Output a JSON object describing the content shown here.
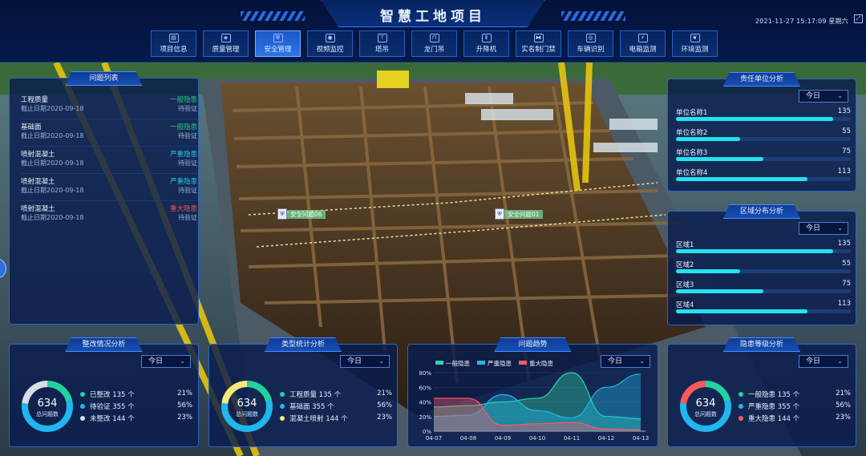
{
  "header": {
    "title": "智慧工地项目",
    "datetime": "2021-11-27 15:17:09 星期六",
    "fullscreen_icon": "fullscreen-icon"
  },
  "nav": [
    {
      "label": "项目信息",
      "icon": "document-icon",
      "active": false
    },
    {
      "label": "质量管理",
      "icon": "quality-badge-icon",
      "active": false
    },
    {
      "label": "安全管理",
      "icon": "shield-icon",
      "active": true
    },
    {
      "label": "视频监控",
      "icon": "camera-icon",
      "active": false
    },
    {
      "label": "塔吊",
      "icon": "tower-crane-icon",
      "active": false
    },
    {
      "label": "龙门吊",
      "icon": "gantry-crane-icon",
      "active": false
    },
    {
      "label": "升降机",
      "icon": "elevator-icon",
      "active": false
    },
    {
      "label": "实名制门禁",
      "icon": "gate-icon",
      "active": false
    },
    {
      "label": "车辆识别",
      "icon": "car-icon",
      "active": false
    },
    {
      "label": "电箱监测",
      "icon": "electric-box-icon",
      "active": false
    },
    {
      "label": "环境监测",
      "icon": "leaf-icon",
      "active": false
    }
  ],
  "issue_list": {
    "title": "问题列表",
    "items": [
      {
        "name": "工程质量",
        "date": "截止日期2020-09-18",
        "level": "一般隐患",
        "level_color": "#22c97a",
        "status": "待验证"
      },
      {
        "name": "基础面",
        "date": "截止日期2020-09-18",
        "level": "一般隐患",
        "level_color": "#22c97a",
        "status": "待验证"
      },
      {
        "name": "喷射混凝土",
        "date": "截止日期2020-09-18",
        "level": "严重隐患",
        "level_color": "#22c8e8",
        "status": "待验证"
      },
      {
        "name": "喷射混凝土",
        "date": "截止日期2020-09-18",
        "level": "严重隐患",
        "level_color": "#22c8e8",
        "status": "待验证"
      },
      {
        "name": "喷射混凝土",
        "date": "截止日期2020-09-18",
        "level": "重大隐患",
        "level_color": "#ff4d4d",
        "status": "待验证"
      }
    ]
  },
  "responsible_units": {
    "title": "责任单位分析",
    "select": "今日",
    "max": 150,
    "items": [
      {
        "label": "单位名称1",
        "value": 135
      },
      {
        "label": "单位名称2",
        "value": 55
      },
      {
        "label": "单位名称3",
        "value": 75
      },
      {
        "label": "单位名称4",
        "value": 113
      }
    ]
  },
  "area_distribution": {
    "title": "区域分布分析",
    "select": "今日",
    "max": 150,
    "items": [
      {
        "label": "区域1",
        "value": 135
      },
      {
        "label": "区域2",
        "value": 55
      },
      {
        "label": "区域3",
        "value": 75
      },
      {
        "label": "区域4",
        "value": 113
      }
    ]
  },
  "rectification": {
    "title": "整改情况分析",
    "select": "今日",
    "total": "634",
    "total_label": "总问题数",
    "items": [
      {
        "label": "已整改 135 个",
        "pct": "21%",
        "value": 21,
        "color": "#22d3a0"
      },
      {
        "label": "待验证 355 个",
        "pct": "56%",
        "value": 56,
        "color": "#1fb7ee"
      },
      {
        "label": "未整改 144 个",
        "pct": "23%",
        "value": 23,
        "color": "#d8dde6"
      }
    ]
  },
  "type_stats": {
    "title": "类型统计分析",
    "select": "今日",
    "total": "634",
    "total_label": "总问题数",
    "items": [
      {
        "label": "工程质量 135 个",
        "pct": "21%",
        "value": 21,
        "color": "#22d3a0"
      },
      {
        "label": "基础面 355 个",
        "pct": "56%",
        "value": 56,
        "color": "#1fb7ee"
      },
      {
        "label": "混凝土喷射 144 个",
        "pct": "23%",
        "value": 23,
        "color": "#f5e97a"
      }
    ]
  },
  "hazard_levels": {
    "title": "隐患等级分析",
    "select": "今日",
    "total": "634",
    "total_label": "总问题数",
    "items": [
      {
        "label": "一般隐患 135 个",
        "pct": "21%",
        "value": 21,
        "color": "#22d3a0"
      },
      {
        "label": "严重隐患 355 个",
        "pct": "56%",
        "value": 56,
        "color": "#1fb7ee"
      },
      {
        "label": "重大隐患 144 个",
        "pct": "23%",
        "value": 23,
        "color": "#ff5a5a"
      }
    ]
  },
  "trend": {
    "title": "问题趋势",
    "select": "今日"
  },
  "markers": [
    {
      "label": "安全问题06",
      "icon": "shield-marker-icon"
    },
    {
      "label": "安全问题01",
      "icon": "shield-marker-icon"
    }
  ],
  "chart_data": {
    "type": "area",
    "x": [
      "04-07",
      "04-08",
      "04-09",
      "04-10",
      "04-11",
      "04-12",
      "04-13"
    ],
    "ylim": [
      0,
      80
    ],
    "yticks": [
      "0%",
      "20%",
      "40%",
      "60%",
      "80%"
    ],
    "series": [
      {
        "name": "一般隐患",
        "color": "#2fd6a6",
        "values": [
          33,
          35,
          40,
          45,
          80,
          20,
          17
        ]
      },
      {
        "name": "严重隐患",
        "color": "#22b8e8",
        "values": [
          20,
          22,
          50,
          28,
          18,
          60,
          78
        ]
      },
      {
        "name": "重大隐患",
        "color": "#ff5a6a",
        "values": [
          45,
          45,
          8,
          10,
          12,
          3,
          2
        ]
      }
    ]
  }
}
